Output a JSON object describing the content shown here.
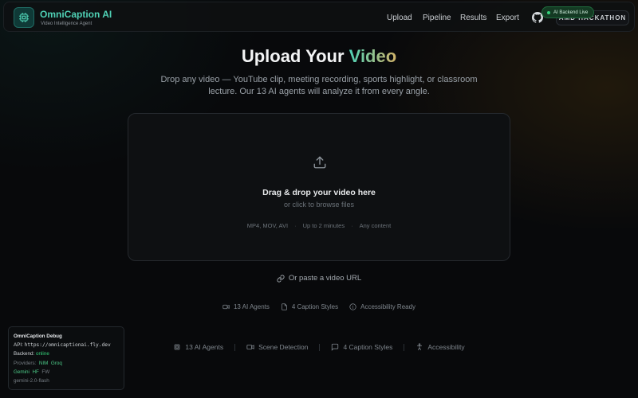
{
  "brand": {
    "name": "OmniCaption AI",
    "tagline": "Video Intelligence Agent"
  },
  "nav": {
    "links": [
      "Upload",
      "Pipeline",
      "Results",
      "Export"
    ],
    "hackathon_badge": "AMD HACKATHON",
    "status_pill": "AI Backend Live"
  },
  "hero": {
    "title_prefix": "Upload Your ",
    "title_accent": "Video",
    "description": "Drop any video — YouTube clip, meeting recording, sports highlight, or classroom lecture. Our 13 AI agents will analyze it from every angle."
  },
  "dropzone": {
    "title": "Drag & drop your video here",
    "subtitle": "or click to browse files",
    "meta": [
      "MP4, MOV, AVI",
      "Up to 2 minutes",
      "Any content"
    ],
    "meta_sep": "·"
  },
  "url_link": "Or paste a video URL",
  "features_primary": [
    "13 AI Agents",
    "4 Caption Styles",
    "Accessibility Ready"
  ],
  "features_secondary": [
    "13 AI Agents",
    "Scene Detection",
    "4 Caption Styles",
    "Accessibility"
  ],
  "debug": {
    "title": "OmniCaption Debug",
    "api_label": "API:",
    "api_value": "https://omnicaptionai.fly.dev",
    "backend_label": "Backend:",
    "backend_value": "online",
    "providers_label": "Providers:",
    "providers": [
      "NIM",
      "Groq",
      "Gemini",
      "HF",
      "FW"
    ],
    "model": "gemini-2.0-flash"
  },
  "colors": {
    "accent_teal": "#4fd1b5",
    "accent_gold": "#d2b46a",
    "status_green": "#34d27a",
    "background": "#08090b"
  }
}
